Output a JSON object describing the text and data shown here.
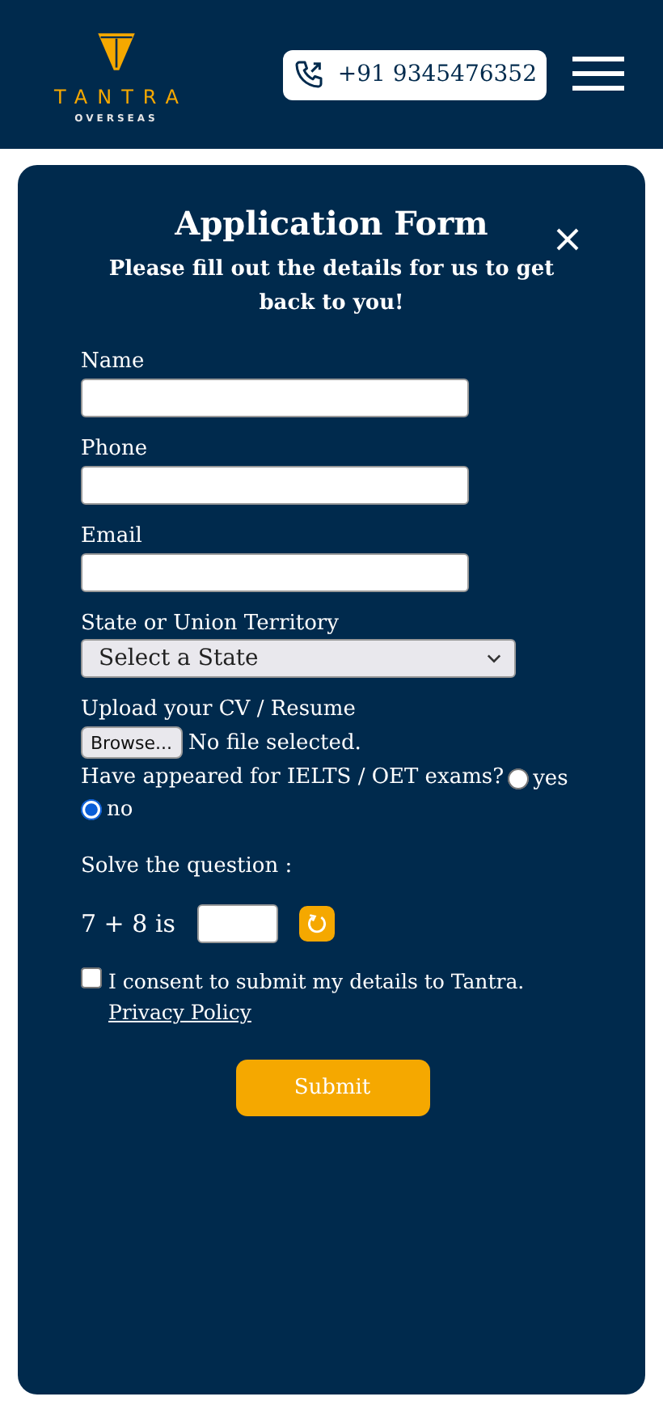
{
  "header": {
    "logo": {
      "name": "TANTRA",
      "tagline": "OVERSEAS"
    },
    "phone": "+91 9345476352"
  },
  "form": {
    "title": "Application Form",
    "subtitle": "Please fill out the details for us to get back to you!",
    "fields": [
      {
        "kind": "text",
        "label": "Name"
      },
      {
        "kind": "text",
        "label": "Phone"
      },
      {
        "kind": "text",
        "label": "Email"
      },
      {
        "kind": "select",
        "label": "State or Union Territory",
        "value": "Select a State"
      },
      {
        "kind": "file",
        "label": "Upload your CV / Resume",
        "button": "Browse...",
        "status": "No file selected."
      }
    ],
    "exam": {
      "question": "Have appeared for IELTS / OET exams?",
      "options": [
        {
          "label": "yes",
          "selected": false
        },
        {
          "label": "no",
          "selected": true
        }
      ]
    },
    "captcha": {
      "heading": "Solve the question :",
      "question": "7 + 8 is"
    },
    "consent": {
      "text": "I consent to submit my details to Tantra.",
      "link": "Privacy Policy",
      "checked": false
    },
    "submit": "Submit"
  }
}
